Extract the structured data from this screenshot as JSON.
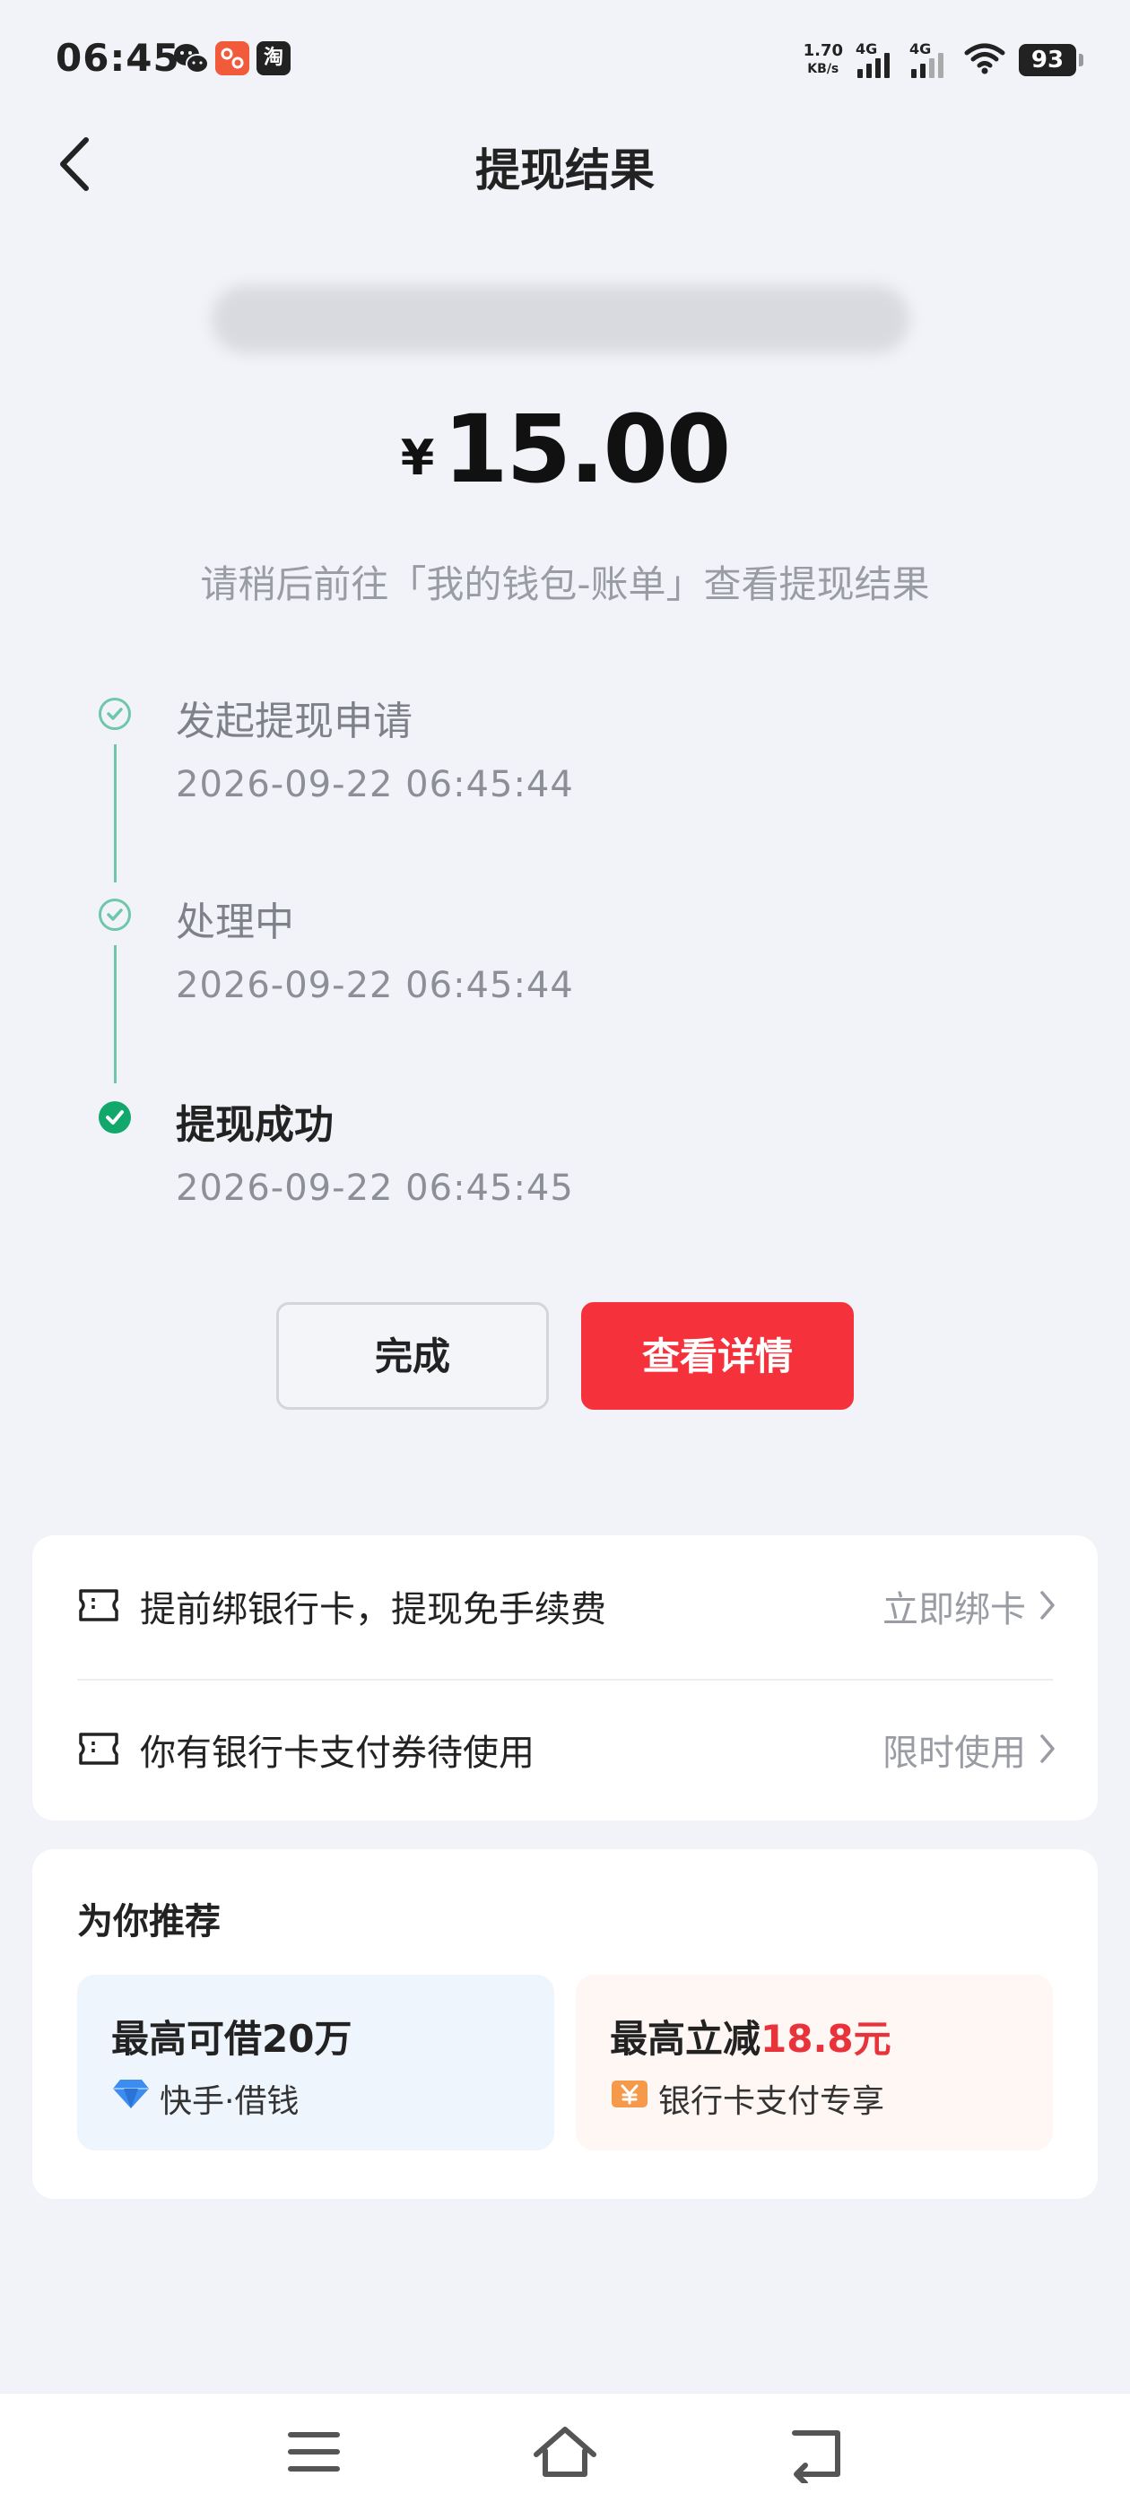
{
  "status_bar": {
    "time": "06:45",
    "notification_icons": [
      "wechat-icon",
      "app-icon",
      "taobao-icon"
    ],
    "taobao_glyph": "淘",
    "net_speed_value": "1.70",
    "net_speed_unit": "KB/s",
    "signal_1_label": "4G",
    "signal_2_label": "4G",
    "battery": "93"
  },
  "header": {
    "title": "提现结果"
  },
  "amount": {
    "currency": "¥",
    "value": "15.00"
  },
  "hint": "请稍后前往「我的钱包-账单」查看提现结果",
  "timeline": [
    {
      "title": "发起提现申请",
      "time": "2026-09-22 06:45:44",
      "state": "done"
    },
    {
      "title": "处理中",
      "time": "2026-09-22 06:45:44",
      "state": "done"
    },
    {
      "title": "提现成功",
      "time": "2026-09-22 06:45:45",
      "state": "current"
    }
  ],
  "buttons": {
    "done_label": "完成",
    "detail_label": "查看详情"
  },
  "offers": [
    {
      "text": "提前绑银行卡，提现免手续费",
      "action": "立即绑卡",
      "icon": "ticket-icon"
    },
    {
      "text": "你有银行卡支付券待使用",
      "action": "限时使用",
      "icon": "ticket-icon"
    }
  ],
  "recommend": {
    "title": "为你推荐",
    "tiles": [
      {
        "headline": "最高可借20万",
        "highlight": "",
        "sub": "快手·借钱",
        "icon": "diamond-icon",
        "color": "#3d8cf0"
      },
      {
        "headline": "最高立减",
        "highlight": "18.8元",
        "sub": "银行卡支付专享",
        "icon": "yuan-coupon-icon",
        "color": "#f59a4a"
      }
    ]
  },
  "colors": {
    "accent_red": "#f5323b",
    "success_green": "#12a86b",
    "timeline_green": "#6fc7aa"
  },
  "nav": [
    "menu-icon",
    "home-icon",
    "back-icon"
  ]
}
